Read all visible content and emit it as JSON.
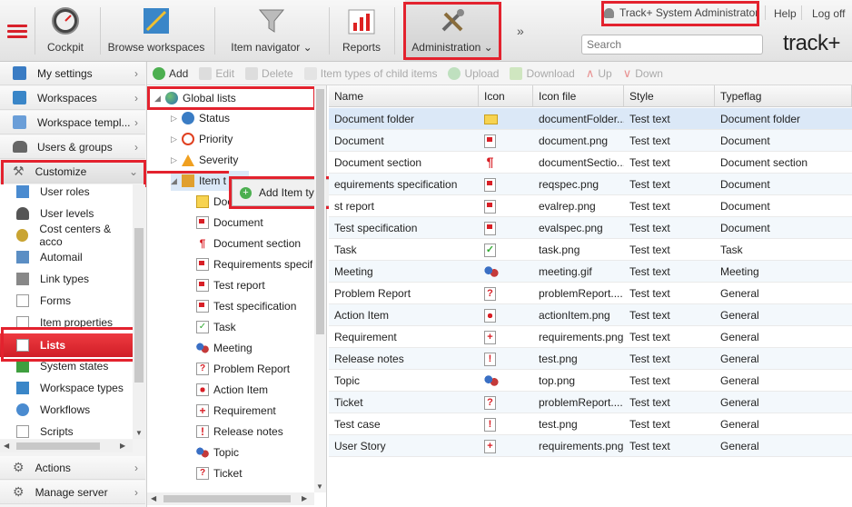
{
  "topbar": {
    "menu_icon": "hamburger-icon",
    "buttons": [
      {
        "label": "Cockpit",
        "icon": "gauge-icon"
      },
      {
        "label": "Browse workspaces",
        "icon": "workspace-icon"
      },
      {
        "label": "Item navigator",
        "icon": "funnel-icon"
      },
      {
        "label": "Reports",
        "icon": "chart-icon"
      },
      {
        "label": "Administration",
        "icon": "tools-icon"
      }
    ],
    "more": "»",
    "user": "Track+ System Administrator",
    "help": "Help",
    "logoff": "Log off",
    "search_placeholder": "Search",
    "logo": "track+"
  },
  "toolbar": {
    "add": "Add",
    "edit": "Edit",
    "delete": "Delete",
    "item_types_child": "Item types of child items",
    "upload": "Upload",
    "download": "Download",
    "up": "Up",
    "down": "Down"
  },
  "sidebar": {
    "my_settings": "My settings",
    "workspaces": "Workspaces",
    "workspace_templates": "Workspace templ...",
    "users_groups": "Users & groups",
    "customize": "Customize",
    "sub": [
      "User roles",
      "User levels",
      "Cost centers & acco",
      "Automail",
      "Link types",
      "Forms",
      "Item properties",
      "Lists",
      "System states",
      "Workspace types",
      "Workflows",
      "Scripts"
    ],
    "actions": "Actions",
    "manage_server": "Manage server"
  },
  "tree": {
    "global_lists": "Global lists",
    "status": "Status",
    "priority": "Priority",
    "severity": "Severity",
    "item_types": "Item t",
    "children": [
      "Docu",
      "Document",
      "Document section",
      "Requirements specific",
      "Test report",
      "Test specification",
      "Task",
      "Meeting",
      "Problem Report",
      "Action Item",
      "Requirement",
      "Release notes",
      "Topic",
      "Ticket"
    ],
    "context_menu": "Add Item type"
  },
  "grid": {
    "headers": [
      "Name",
      "Icon",
      "Icon file",
      "Style",
      "Typeflag"
    ],
    "rows": [
      {
        "name": "Document folder",
        "file": "documentFolder...",
        "style": "Test text",
        "flag": "Document folder",
        "icon": "folder-icon"
      },
      {
        "name": "Document",
        "file": "document.png",
        "style": "Test text",
        "flag": "Document",
        "icon": "document-icon"
      },
      {
        "name": "Document section",
        "file": "documentSectio...",
        "style": "Test text",
        "flag": "Document section",
        "icon": "pilcrow-icon"
      },
      {
        "name": "equirements specification",
        "file": "reqspec.png",
        "style": "Test text",
        "flag": "Document",
        "icon": "document-icon"
      },
      {
        "name": "st report",
        "file": "evalrep.png",
        "style": "Test text",
        "flag": "Document",
        "icon": "document-icon"
      },
      {
        "name": "Test specification",
        "file": "evalspec.png",
        "style": "Test text",
        "flag": "Document",
        "icon": "document-icon"
      },
      {
        "name": "Task",
        "file": "task.png",
        "style": "Test text",
        "flag": "Task",
        "icon": "task-icon"
      },
      {
        "name": "Meeting",
        "file": "meeting.gif",
        "style": "Test text",
        "flag": "Meeting",
        "icon": "meeting-icon"
      },
      {
        "name": "Problem Report",
        "file": "problemReport....",
        "style": "Test text",
        "flag": "General",
        "icon": "problem-icon"
      },
      {
        "name": "Action Item",
        "file": "actionItem.png",
        "style": "Test text",
        "flag": "General",
        "icon": "action-icon"
      },
      {
        "name": "Requirement",
        "file": "requirements.png",
        "style": "Test text",
        "flag": "General",
        "icon": "requirement-icon"
      },
      {
        "name": "Release notes",
        "file": "test.png",
        "style": "Test text",
        "flag": "General",
        "icon": "exclaim-icon"
      },
      {
        "name": "Topic",
        "file": "top.png",
        "style": "Test text",
        "flag": "General",
        "icon": "meeting-icon"
      },
      {
        "name": "Ticket",
        "file": "problemReport....",
        "style": "Test text",
        "flag": "General",
        "icon": "problem-icon"
      },
      {
        "name": "Test case",
        "file": "test.png",
        "style": "Test text",
        "flag": "General",
        "icon": "exclaim-icon"
      },
      {
        "name": "User Story",
        "file": "requirements.png",
        "style": "Test text",
        "flag": "General",
        "icon": "requirement-icon"
      }
    ]
  },
  "colors": {
    "accent": "#e3222e",
    "selected": "#e0252f",
    "row_alt": "#f3f8fc"
  }
}
